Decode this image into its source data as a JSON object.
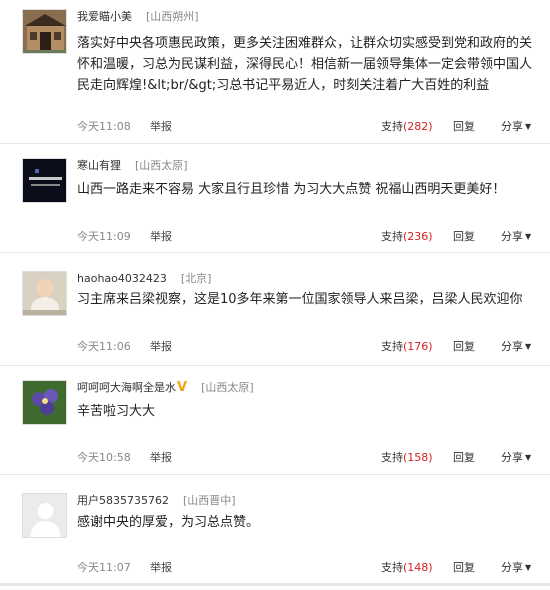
{
  "comments": [
    {
      "username": "我爱瞄小美",
      "location": "[山西朔州]",
      "text": "落实好中央各项惠民政策，更多关注困难群众，让群众切实感受到党和政府的关怀和温暖，习总为民谋利益，深得民心！相信新一届领导集体一定会带领中国人民走向辉煌!&lt;br/&gt;习总书记平易近人，时刻关注着广大百姓的利益",
      "time": "今天11:08",
      "report": "举报",
      "support_label": "支持",
      "support_count": "(282)",
      "reply": "回复",
      "share": "分享",
      "share_arrow": "▼"
    },
    {
      "username": "寒山有狸",
      "location": "[山西太原]",
      "text": "山西一路走来不容易 大家且行且珍惜 为习大大点赞 祝福山西明天更美好！",
      "time": "今天11:09",
      "report": "举报",
      "support_label": "支持",
      "support_count": "(236)",
      "reply": "回复",
      "share": "分享",
      "share_arrow": "▼"
    },
    {
      "username": "haohao4032423",
      "location": "[北京]",
      "text": "习主席来吕梁视察，这是10多年来第一位国家领导人来吕梁，吕梁人民欢迎你",
      "time": "今天11:06",
      "report": "举报",
      "support_label": "支持",
      "support_count": "(176)",
      "reply": "回复",
      "share": "分享",
      "share_arrow": "▼"
    },
    {
      "username": "呵呵呵大海啊全是水",
      "verified_badge": "V",
      "location": "[山西太原]",
      "text": "辛苦啦习大大",
      "time": "今天10:58",
      "report": "举报",
      "support_label": "支持",
      "support_count": "(158)",
      "reply": "回复",
      "share": "分享",
      "share_arrow": "▼"
    },
    {
      "username": "用户5835735762",
      "location": "[山西晋中]",
      "text": "感谢中央的厚爱，为习总点赞。",
      "time": "今天11:07",
      "report": "举报",
      "support_label": "支持",
      "support_count": "(148)",
      "reply": "回复",
      "share": "分享",
      "share_arrow": "▼"
    }
  ],
  "colors": {
    "count_red": "#d52121",
    "meta_gray": "#888888",
    "badge_gold": "#f3a40f",
    "divider": "#e6e6e6"
  },
  "avatar_icons": [
    "house-photo-avatar",
    "dark-text-avatar",
    "baby-photo-avatar",
    "flower-photo-avatar",
    "default-user-avatar"
  ]
}
